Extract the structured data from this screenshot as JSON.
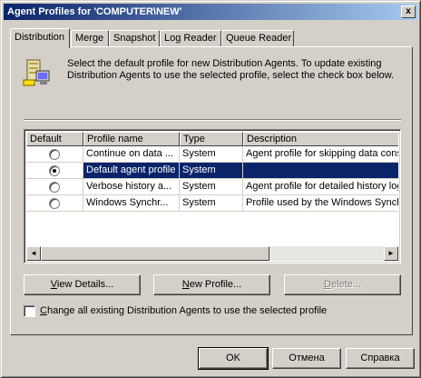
{
  "window": {
    "title": "Agent Profiles for 'COMPUTER\\NEW'",
    "close_label": "x"
  },
  "tabs": [
    {
      "label": "Distribution",
      "active": true
    },
    {
      "label": "Merge"
    },
    {
      "label": "Snapshot"
    },
    {
      "label": "Log Reader"
    },
    {
      "label": "Queue Reader"
    }
  ],
  "intro": {
    "icon": "agent-profile-icon",
    "text": "Select the default profile for new Distribution Agents. To update existing Distribution Agents to use the selected profile, select the check box below."
  },
  "table": {
    "headers": [
      "Default",
      "Profile name",
      "Type",
      "Description"
    ],
    "rows": [
      {
        "default": false,
        "name": "Continue on data ...",
        "type": "System",
        "description": "Agent profile for skipping data consis"
      },
      {
        "default": true,
        "name": "Default agent profile",
        "type": "System",
        "description": "",
        "selected": true
      },
      {
        "default": false,
        "name": "Verbose history a...",
        "type": "System",
        "description": "Agent profile for detailed history logg"
      },
      {
        "default": false,
        "name": "Windows Synchr...",
        "type": "System",
        "description": "Profile used by the Windows Synchr"
      }
    ]
  },
  "scrollbar": {
    "left_arrow": "◄",
    "right_arrow": "►"
  },
  "buttons": {
    "view_details": {
      "mn": "V",
      "rest": "iew Details..."
    },
    "new_profile": {
      "mn": "N",
      "rest": "ew Profile..."
    },
    "delete": {
      "mn": "D",
      "rest": "elete..."
    }
  },
  "checkbox": {
    "mn": "C",
    "rest": "hange all existing Distribution Agents to use the selected profile",
    "checked": false
  },
  "footer": {
    "ok": "OK",
    "cancel": "Отмена",
    "help": "Справка"
  },
  "colors": {
    "titlebar_start": "#0a246a",
    "titlebar_end": "#a6caf0",
    "selection": "#0a246a",
    "face": "#d4d0c8"
  }
}
